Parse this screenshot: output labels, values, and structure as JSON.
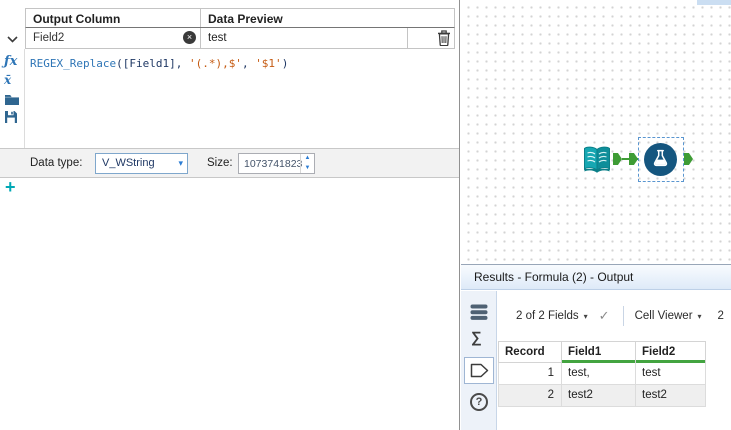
{
  "formula_panel": {
    "header": {
      "output_column": "Output Column",
      "data_preview": "Data Preview"
    },
    "field_row": {
      "name": "Field2",
      "preview": "test"
    },
    "expression": [
      {
        "t": "REGEX_Replace",
        "c": "function"
      },
      {
        "t": "([Field1], ",
        "c": "plain"
      },
      {
        "t": "'(.*),$'",
        "c": "string"
      },
      {
        "t": ", ",
        "c": "plain"
      },
      {
        "t": "'$1'",
        "c": "string"
      },
      {
        "t": ")",
        "c": "plain"
      }
    ],
    "data_type_label": "Data type:",
    "data_type_value": "V_WString",
    "size_label": "Size:",
    "size_value": "1073741823"
  },
  "results_panel": {
    "title": "Results - Formula (2) - Output",
    "toolbar": {
      "fields": "2 of 2 Fields",
      "cell_viewer": "Cell Viewer",
      "truncated": "2"
    },
    "table": {
      "headers": [
        "Record",
        "Field1",
        "Field2"
      ],
      "rows": [
        {
          "record": "1",
          "field1": "test,",
          "field2": "test"
        },
        {
          "record": "2",
          "field1": "test2",
          "field2": "test2"
        }
      ]
    }
  },
  "icons": {
    "fx": "ƒx",
    "xbar": "x̄",
    "clear": "×",
    "caret_down": "▾",
    "spin_up": "▲",
    "spin_down": "▼",
    "add": "+",
    "check": "✓",
    "sigma": "∑",
    "help": "?"
  },
  "colors": {
    "accent_teal": "#00A8B5",
    "function_blue": "#2E75B6",
    "string_orange": "#C55A11",
    "expression_navy": "#1F3864",
    "connector_green": "#3E9C35",
    "formula_tool_blue": "#15567F",
    "quality_green": "#43A440"
  }
}
